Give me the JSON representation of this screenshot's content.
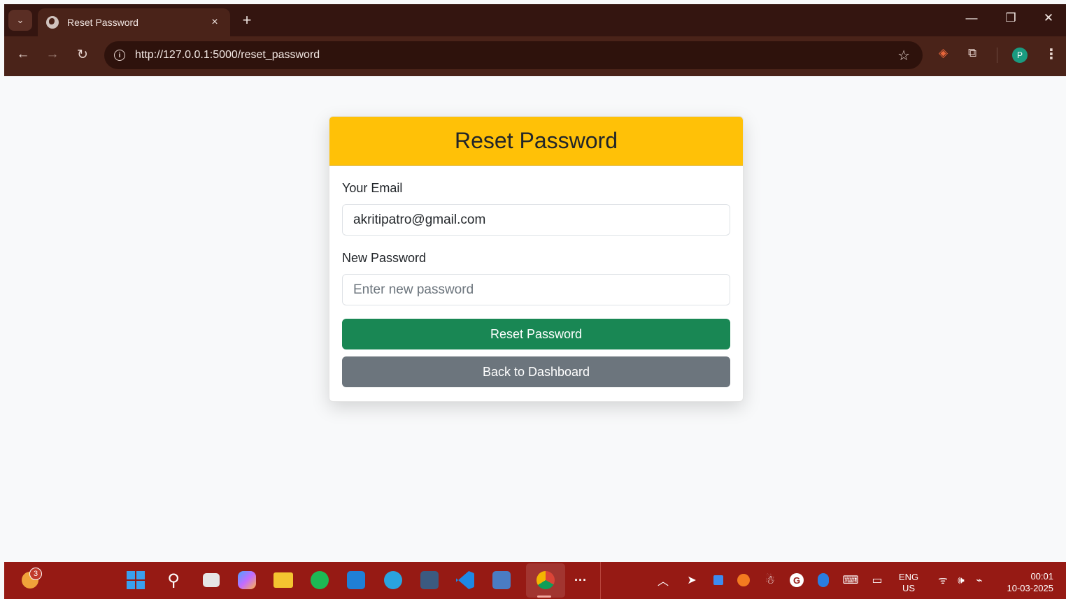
{
  "browser": {
    "tab_title": "Reset Password",
    "tab_close": "×",
    "new_tab": "+",
    "url": "http://127.0.0.1:5000/reset_password",
    "profile_initial": "P"
  },
  "card": {
    "title": "Reset Password",
    "email_label": "Your Email",
    "email_value": "akritipatro@gmail.com",
    "password_label": "New Password",
    "password_placeholder": "Enter new password",
    "submit_label": "Reset Password",
    "back_label": "Back to Dashboard"
  },
  "taskbar": {
    "notification_count": "3",
    "lang_primary": "ENG",
    "lang_secondary": "US",
    "time": "00:01",
    "date": "10-03-2025"
  },
  "colors": {
    "header": "#ffc107",
    "success": "#198754",
    "secondary": "#6c757d",
    "taskbar": "#961a14",
    "chrome": "#4a2319"
  }
}
